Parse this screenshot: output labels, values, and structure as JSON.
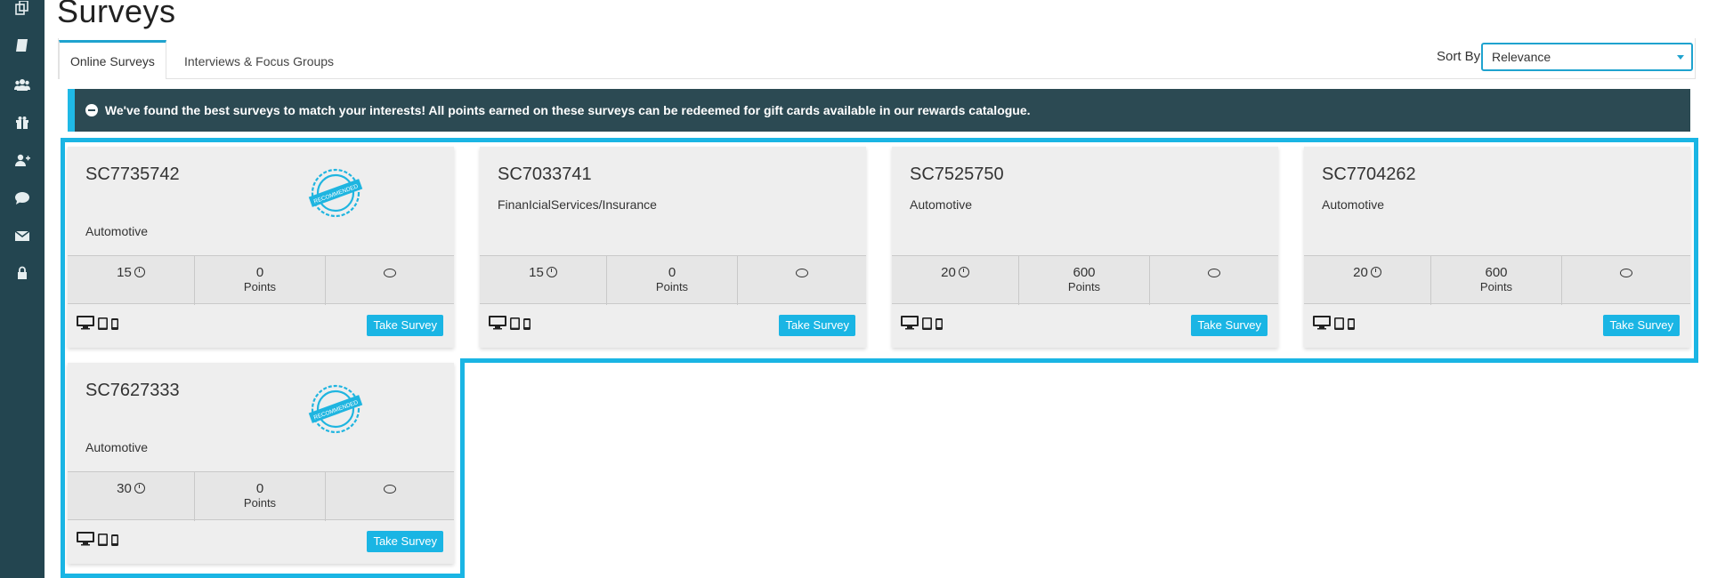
{
  "page": {
    "title": "Surveys"
  },
  "sidebar": {
    "icons": [
      "copy-icon",
      "book-icon",
      "users-icon",
      "gift-icon",
      "add-user-icon",
      "comment-icon",
      "envelope-icon",
      "lock-icon"
    ]
  },
  "tabs": [
    {
      "label": "Online Surveys",
      "active": true
    },
    {
      "label": "Interviews & Focus Groups",
      "active": false
    }
  ],
  "sort": {
    "label": "Sort By",
    "selected": "Relevance"
  },
  "banner": {
    "text": "We've found the best surveys to match your interests! All points earned on these surveys can be redeemed for gift cards available in our rewards catalogue."
  },
  "colors": {
    "sidebar": "#234550",
    "accent": "#1ab5e4",
    "banner": "#2c4a53"
  },
  "surveys": [
    {
      "id": "SC7735742",
      "category": "Automotive",
      "recommended": true,
      "minutes": "15",
      "points": "0",
      "points_label": "Points",
      "button": "Take Survey"
    },
    {
      "id": "SC7033741",
      "category": "FinanIcialServices/Insurance",
      "recommended": false,
      "minutes": "15",
      "points": "0",
      "points_label": "Points",
      "button": "Take Survey"
    },
    {
      "id": "SC7525750",
      "category": "Automotive",
      "recommended": false,
      "minutes": "20",
      "points": "600",
      "points_label": "Points",
      "button": "Take Survey"
    },
    {
      "id": "SC7704262",
      "category": "Automotive",
      "recommended": false,
      "minutes": "20",
      "points": "600",
      "points_label": "Points",
      "button": "Take Survey"
    },
    {
      "id": "SC7627333",
      "category": "Automotive",
      "recommended": true,
      "minutes": "30",
      "points": "0",
      "points_label": "Points",
      "button": "Take Survey"
    }
  ]
}
